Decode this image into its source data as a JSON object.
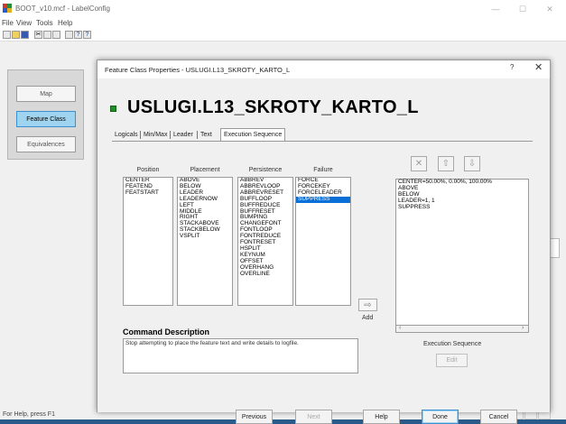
{
  "app": {
    "title": "BOOT_v10.mcf - LabelConfig"
  },
  "window_controls": {
    "minimize": "—",
    "maximize": "☐",
    "close": "✕"
  },
  "menu": [
    "File",
    "View",
    "Tools",
    "Help"
  ],
  "toolbar_icons": [
    "new-icon",
    "open-icon",
    "save-icon",
    "cut-icon",
    "copy-icon",
    "paste-icon",
    "print-icon",
    "help-icon",
    "context-help-icon"
  ],
  "nav": {
    "map": "Map",
    "feature_class": "Feature Class",
    "equivalences": "Equivalences"
  },
  "status": {
    "text": "For Help, press F1"
  },
  "dialog": {
    "title": "Feature Class Properties - USLUGI.L13_SKROTY_KARTO_L",
    "help_glyph": "?",
    "close_glyph": "✕",
    "feature_name": "USLUGI.L13_SKROTY_KARTO_L",
    "tabs": [
      "Logicals",
      "Min/Max",
      "Leader",
      "Text",
      "Execution Sequence"
    ],
    "active_tab": "Execution Sequence",
    "columns": {
      "position": {
        "header": "Position",
        "items": [
          "CENTER",
          "FEATEND",
          "FEATSTART"
        ]
      },
      "placement": {
        "header": "Placement",
        "items": [
          "ABOVE",
          "BELOW",
          "LEADER",
          "LEADERNOW",
          "LEFT",
          "MIDDLE",
          "RIGHT",
          "STACKABOVE",
          "STACKBELOW",
          "VSPLIT"
        ]
      },
      "persistence": {
        "header": "Persistence",
        "items": [
          "ABBREV",
          "ABBREVLOOP",
          "ABBREVRESET",
          "BUFFLOOP",
          "BUFFREDUCE",
          "BUFFRESET",
          "BUMPING",
          "CHANGEFONT",
          "FONTLOOP",
          "FONTREDUCE",
          "FONTRESET",
          "HSPLIT",
          "KEYNUM",
          "OFFSET",
          "OVERHANG",
          "OVERLINE"
        ]
      },
      "failure": {
        "header": "Failure",
        "items": [
          "FORCE",
          "FORCEKEY",
          "FORCELEADER",
          "SUPPRESS"
        ],
        "selected": "SUPPRESS"
      }
    },
    "add": {
      "label": "Add",
      "icon": "right-arrow-icon"
    },
    "sequence_buttons": {
      "delete": "✕",
      "move_up": "⇧",
      "move_down": "⇩"
    },
    "execution_sequence": {
      "items": [
        "CENTER=50.00%, 0.00%, 100.00%",
        "ABOVE",
        "BELOW",
        "LEADER=1, 1",
        "SUPPRESS"
      ],
      "label": "Execution Sequence",
      "edit": "Edit"
    },
    "command_description": {
      "header": "Command Description",
      "text": "Stop attempting to place the feature text and write details to logfile."
    },
    "buttons": {
      "previous": "Previous",
      "next": "Next",
      "help": "Help",
      "done": "Done",
      "cancel": "Cancel"
    }
  }
}
